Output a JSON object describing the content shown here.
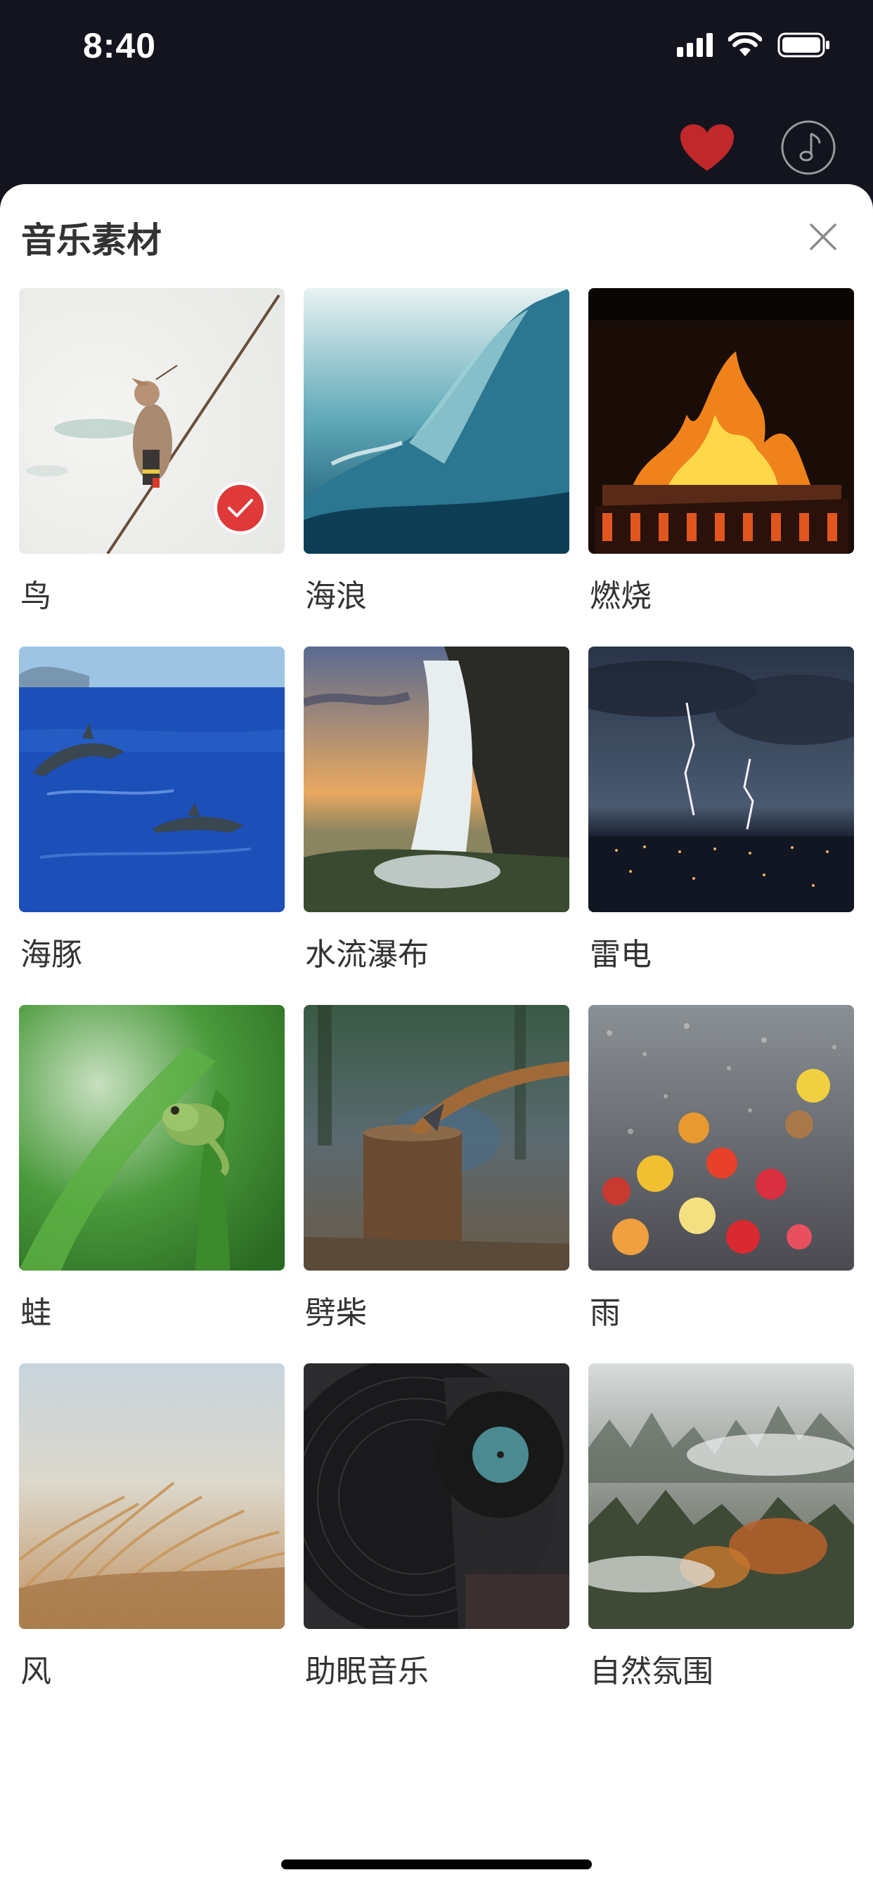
{
  "status_bar": {
    "time": "8:40"
  },
  "top_actions": {
    "heart_color": "#c0282b",
    "icons": [
      "heart-icon",
      "music-note-icon"
    ]
  },
  "sheet": {
    "title": "音乐素材",
    "close_icon": "close-icon",
    "items": [
      {
        "label": "鸟",
        "selected": true,
        "image": "bird-on-branch"
      },
      {
        "label": "海浪",
        "selected": false,
        "image": "ocean-wave"
      },
      {
        "label": "燃烧",
        "selected": false,
        "image": "fireplace"
      },
      {
        "label": "海豚",
        "selected": false,
        "image": "dolphins"
      },
      {
        "label": "水流瀑布",
        "selected": false,
        "image": "waterfall"
      },
      {
        "label": "雷电",
        "selected": false,
        "image": "lightning"
      },
      {
        "label": "蛙",
        "selected": false,
        "image": "frog"
      },
      {
        "label": "劈柴",
        "selected": false,
        "image": "axe-in-log"
      },
      {
        "label": "雨",
        "selected": false,
        "image": "rain-on-glass"
      },
      {
        "label": "风",
        "selected": false,
        "image": "wind-grass"
      },
      {
        "label": "助眠音乐",
        "selected": false,
        "image": "vinyl-record"
      },
      {
        "label": "自然氛围",
        "selected": false,
        "image": "misty-forest"
      }
    ]
  },
  "accent_color": "#e0393a"
}
